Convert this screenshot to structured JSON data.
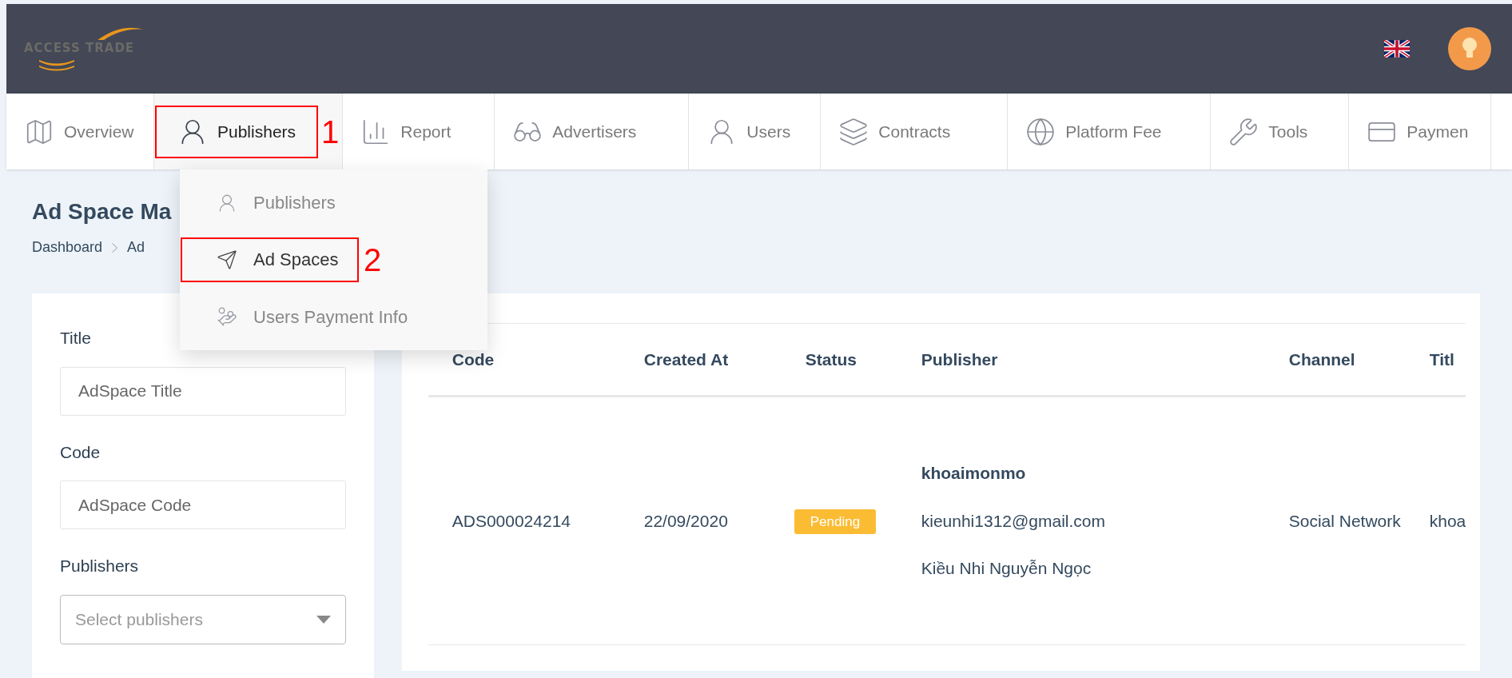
{
  "header": {
    "logo": "ACCESS TRADE"
  },
  "nav": [
    {
      "label": "Overview",
      "selected": false
    },
    {
      "label": "Publishers",
      "selected": true,
      "annotation": "1"
    },
    {
      "label": "Report",
      "selected": false
    },
    {
      "label": "Advertisers",
      "selected": false
    },
    {
      "label": "Users",
      "selected": false
    },
    {
      "label": "Contracts",
      "selected": false
    },
    {
      "label": "Platform Fee",
      "selected": false
    },
    {
      "label": "Tools",
      "selected": false
    },
    {
      "label": "Paymen",
      "selected": false
    }
  ],
  "dropdown": [
    {
      "label": "Publishers",
      "selected": false
    },
    {
      "label": "Ad Spaces",
      "selected": true,
      "annotation": "2"
    },
    {
      "label": "Users Payment Info",
      "selected": false
    }
  ],
  "page": {
    "title": "Ad Space Ma",
    "breadcrumb": [
      "Dashboard",
      "Ad"
    ]
  },
  "filters": [
    {
      "label": "Title",
      "kind": "text",
      "placeholder": "AdSpace Title"
    },
    {
      "label": "Code",
      "kind": "text",
      "placeholder": "AdSpace Code"
    },
    {
      "label": "Publishers",
      "kind": "select",
      "placeholder": "Select publishers"
    }
  ],
  "table": {
    "columns": [
      "Code",
      "Created At",
      "Status",
      "Publisher",
      "Channel",
      "Titl"
    ],
    "rows": [
      {
        "code": "ADS000024214",
        "created_at": "22/09/2020",
        "status": "Pending",
        "publisher": {
          "username": "khoaimonmo",
          "email": "kieunhi1312@gmail.com",
          "name": "Kiều Nhi Nguyễn Ngọc"
        },
        "channel": "Social Network",
        "title": "khoa"
      }
    ]
  }
}
